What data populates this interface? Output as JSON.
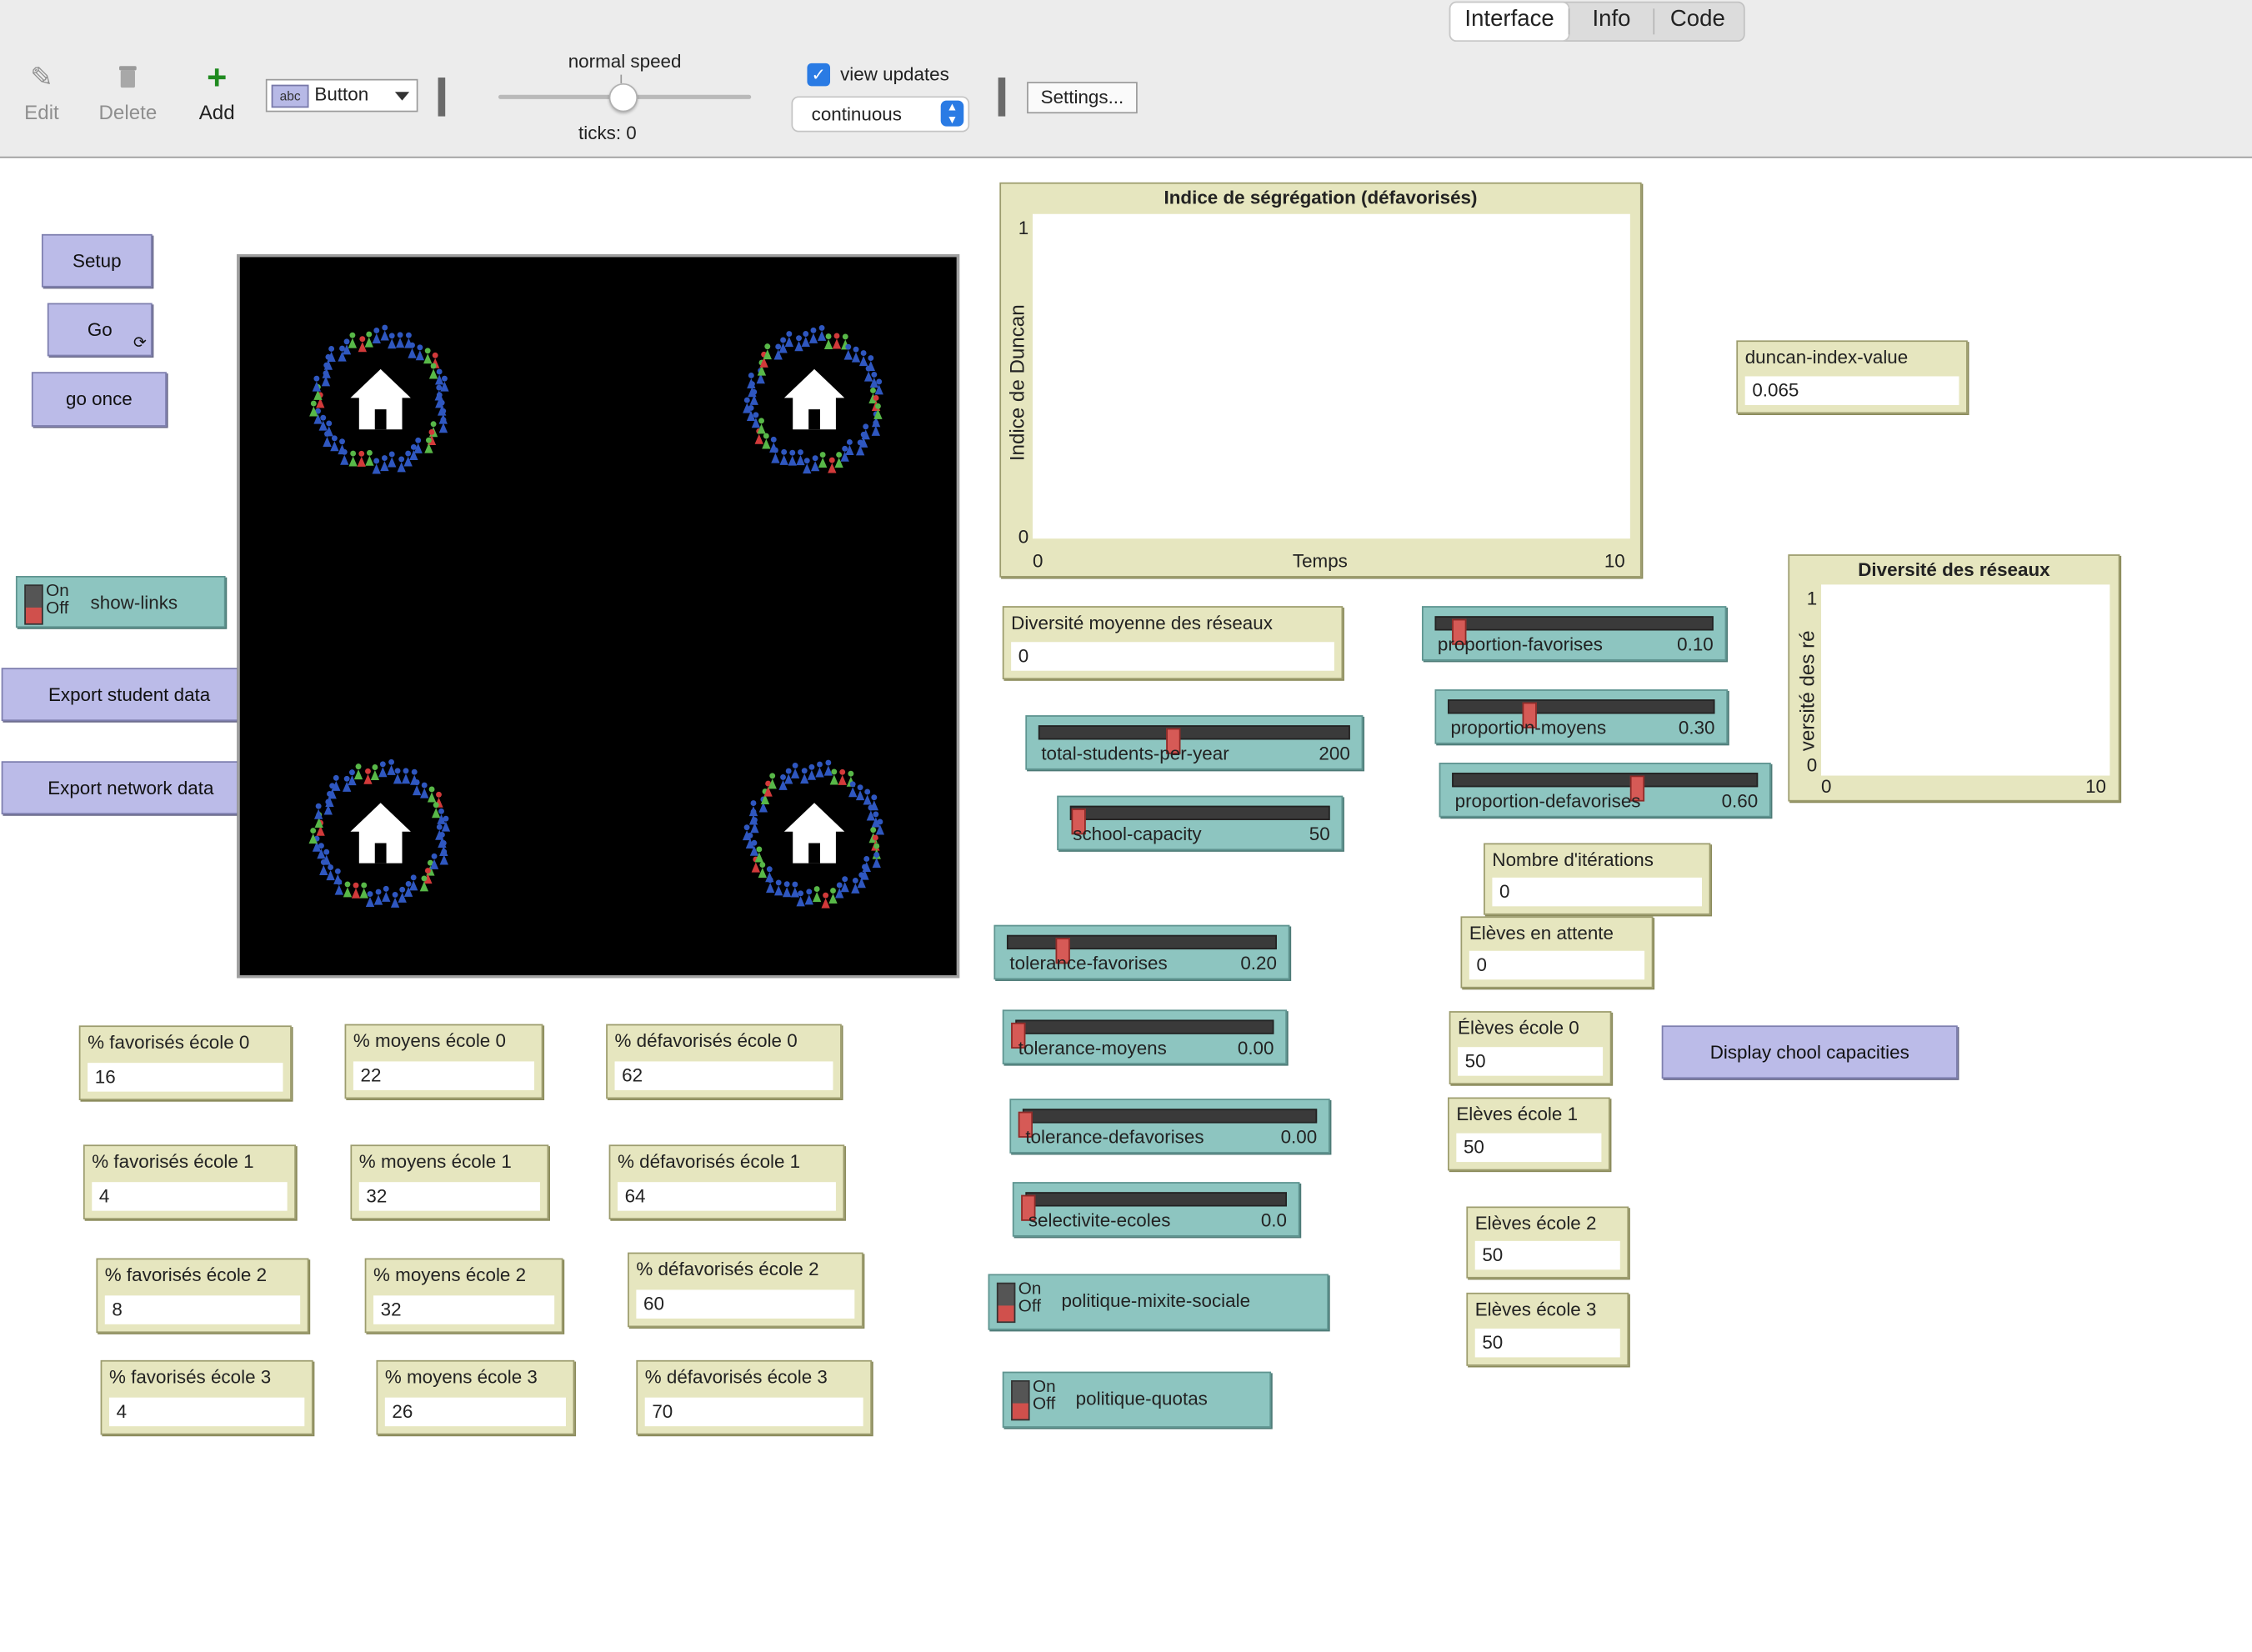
{
  "tabs": [
    "Interface",
    "Info",
    "Code"
  ],
  "toolbar": {
    "edit": "Edit",
    "delete": "Delete",
    "add": "Add",
    "widget_type": "Button",
    "widget_icon_text": "abc",
    "speed_label": "normal speed",
    "ticks_label": "ticks: 0",
    "view_updates_label": "view updates",
    "view_updates_checked": true,
    "update_mode": "continuous",
    "settings": "Settings..."
  },
  "buttons": {
    "setup": "Setup",
    "go": "Go",
    "go_once": "go once",
    "export_students": "Export student data",
    "export_network": "Export network data",
    "display_capacities": "Display chool capacities"
  },
  "switches": {
    "on": "On",
    "off": "Off",
    "show_links": "show-links",
    "politique_mixite": "politique-mixite-sociale",
    "politique_quotas": "politique-quotas"
  },
  "plots": {
    "segregation": {
      "title": "Indice de ségrégation (défavorisés)",
      "xlabel": "Temps",
      "ylabel": "Indice de Duncan",
      "xmin": "0",
      "xmax": "10",
      "ymin": "0",
      "ymax": "1"
    },
    "diversite": {
      "title": "Diversité des réseaux",
      "ylabel": "versité des ré",
      "xmin": "0",
      "xmax": "10",
      "ymin": "0",
      "ymax": "1"
    }
  },
  "monitors": {
    "duncan": {
      "label": "duncan-index-value",
      "value": "0.065"
    },
    "diversite_moyenne": {
      "label": "Diversité moyenne des réseaux",
      "value": "0"
    },
    "iterations": {
      "label": "Nombre d'itérations",
      "value": "0"
    },
    "attente": {
      "label": "Elèves en attente",
      "value": "0"
    },
    "eleves0": {
      "label": "Élèves école 0",
      "value": "50"
    },
    "eleves1": {
      "label": "Elèves école 1",
      "value": "50"
    },
    "eleves2": {
      "label": "Elèves école 2",
      "value": "50"
    },
    "eleves3": {
      "label": "Elèves école 3",
      "value": "50"
    },
    "fav0": {
      "label": "% favorisés école 0",
      "value": "16"
    },
    "moy0": {
      "label": "% moyens école 0",
      "value": "22"
    },
    "def0": {
      "label": "% défavorisés école 0",
      "value": "62"
    },
    "fav1": {
      "label": "% favorisés école 1",
      "value": "4"
    },
    "moy1": {
      "label": "% moyens école 1",
      "value": "32"
    },
    "def1": {
      "label": "% défavorisés école 1",
      "value": "64"
    },
    "fav2": {
      "label": "% favorisés école 2",
      "value": "8"
    },
    "moy2": {
      "label": "% moyens école 2",
      "value": "32"
    },
    "def2": {
      "label": "% défavorisés école 2",
      "value": "60"
    },
    "fav3": {
      "label": "% favorisés école 3",
      "value": "4"
    },
    "moy3": {
      "label": "% moyens école 3",
      "value": "26"
    },
    "def3": {
      "label": "% défavorisés école 3",
      "value": "70"
    }
  },
  "sliders": {
    "prop_fav": {
      "name": "proportion-favorises",
      "value": "0.10",
      "fraction": 0.08
    },
    "prop_moy": {
      "name": "proportion-moyens",
      "value": "0.30",
      "fraction": 0.3
    },
    "prop_def": {
      "name": "proportion-defavorises",
      "value": "0.60",
      "fraction": 0.6
    },
    "total_students": {
      "name": "total-students-per-year",
      "value": "200",
      "fraction": 0.43
    },
    "school_capacity": {
      "name": "school-capacity",
      "value": "50",
      "fraction": 0.02
    },
    "tol_fav": {
      "name": "tolerance-favorises",
      "value": "0.20",
      "fraction": 0.2
    },
    "tol_moy": {
      "name": "tolerance-moyens",
      "value": "0.00",
      "fraction": 0.0
    },
    "tol_def": {
      "name": "tolerance-defavorises",
      "value": "0.00",
      "fraction": 0.0
    },
    "selectivite": {
      "name": "selectivite-ecoles",
      "value": "0.0",
      "fraction": 0.0
    }
  },
  "world": {
    "background": "#000000",
    "agent_colors": {
      "favorises": "#58b848",
      "moyens": "#2f57c0",
      "defavorises": "#d23a3a",
      "school": "#ffffff"
    }
  }
}
